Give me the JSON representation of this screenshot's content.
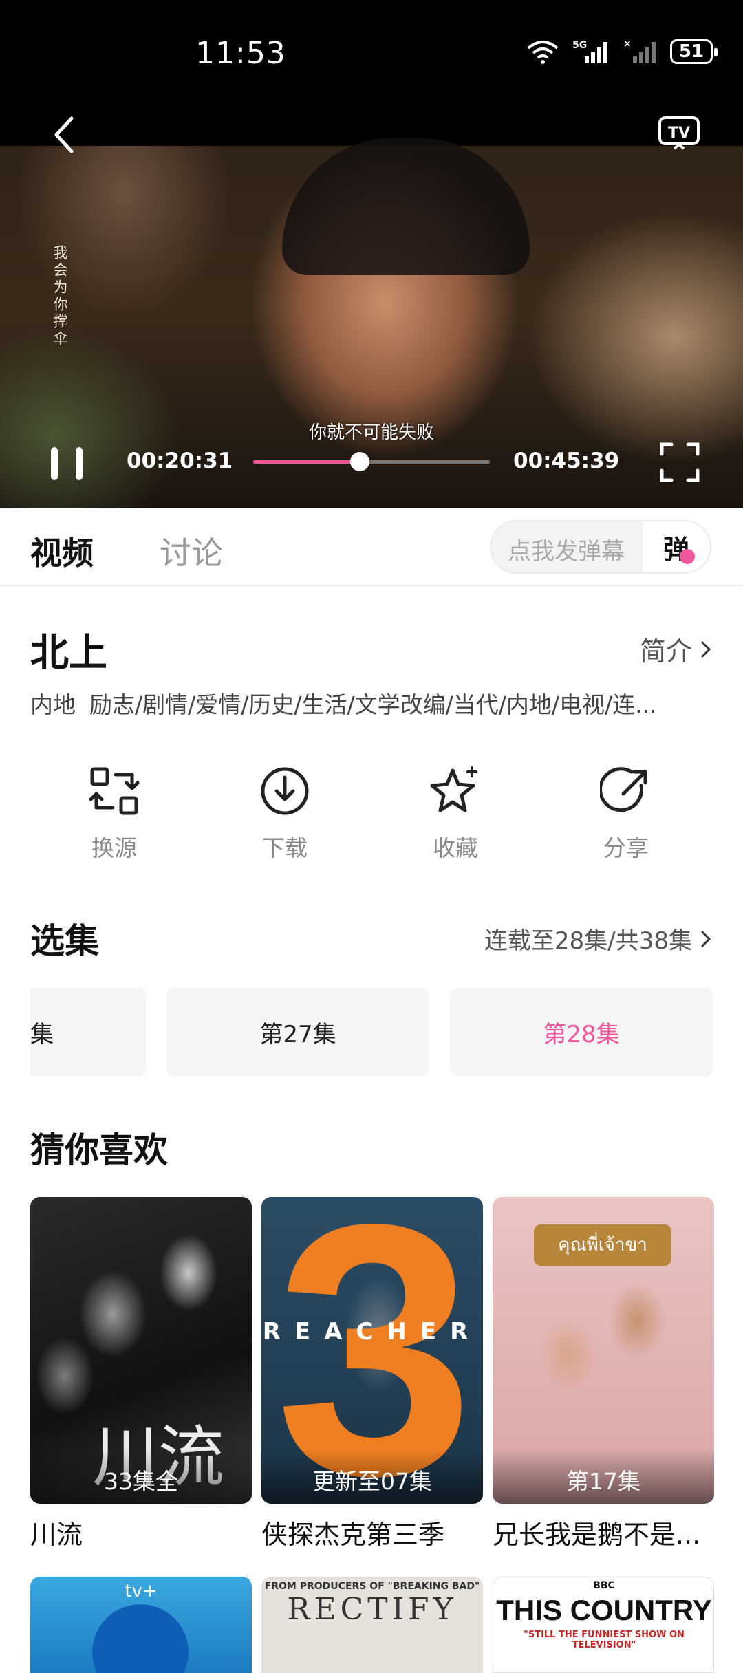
{
  "status": {
    "time": "11:53",
    "battery": "51"
  },
  "video": {
    "vertical_caption": "我会为你撑伞",
    "subtitle": "你就不可能失败",
    "current_time": "00:20:31",
    "total_time": "00:45:39",
    "progress": 0.45
  },
  "tabs": {
    "video": "视频",
    "discuss": "讨论"
  },
  "danmu": {
    "placeholder": "点我发弹幕",
    "button": "弹"
  },
  "show": {
    "title": "北上",
    "intro_link": "简介",
    "region": "内地",
    "genres": "励志/剧情/爱情/历史/生活/文学改编/当代/内地/电视/连..."
  },
  "actions": [
    {
      "label": "换源",
      "icon": "switch-source-icon"
    },
    {
      "label": "下载",
      "icon": "download-icon"
    },
    {
      "label": "收藏",
      "icon": "favorite-star-icon"
    },
    {
      "label": "分享",
      "icon": "share-icon"
    }
  ],
  "episodes": {
    "title": "选集",
    "info": "连载至28集/共38集",
    "items": [
      "集",
      "第27集",
      "第28集"
    ],
    "active_color": "#f0569a"
  },
  "recommend": {
    "title": "猜你喜欢",
    "items": [
      {
        "title": "川流",
        "badge": "33集全",
        "poster_text": "川流"
      },
      {
        "title": "侠探杰克第三季",
        "badge": "更新至07集",
        "poster_text": "REACHER"
      },
      {
        "title": "兄长我是鹅不是...",
        "badge": "第17集",
        "poster_text": "คุณพี่เจ้าขา"
      }
    ],
    "row2": [
      {
        "poster_text": "tv+"
      },
      {
        "poster_tag": "FROM PRODUCERS OF \"BREAKING BAD\"",
        "poster_text": "RECTIFY"
      },
      {
        "poster_tag": "BBC",
        "poster_text": "THIS COUNTRY",
        "poster_sub": "\"STILL THE FUNNIEST SHOW ON TELEVISION\""
      }
    ]
  }
}
